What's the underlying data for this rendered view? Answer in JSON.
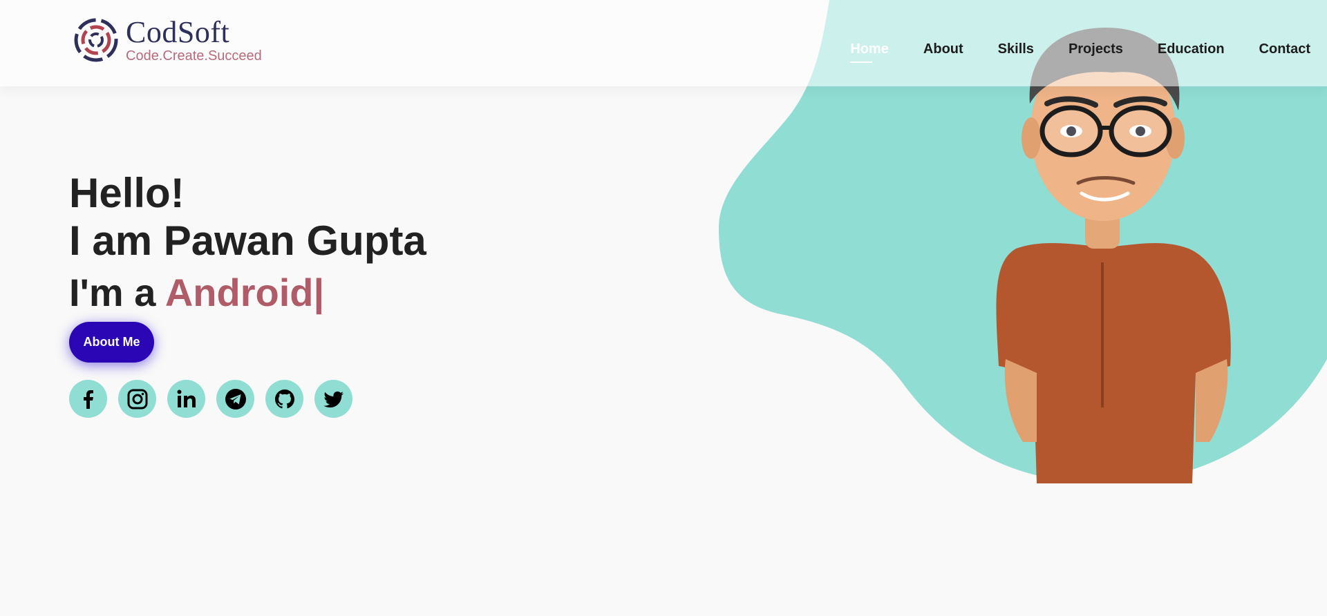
{
  "brand": {
    "name": "CodSoft",
    "tagline": "Code.Create.Succeed"
  },
  "nav": {
    "items": [
      {
        "label": "Home",
        "active": true
      },
      {
        "label": "About"
      },
      {
        "label": "Skills"
      },
      {
        "label": "Projects"
      },
      {
        "label": "Education"
      },
      {
        "label": "Contact"
      }
    ]
  },
  "hero": {
    "greeting": "Hello!",
    "name_line": "I am Pawan Gupta",
    "role_prefix": "I'm a ",
    "role_word": "Android",
    "cursor": "|",
    "about_button": "About Me"
  },
  "socials": [
    {
      "icon": "facebook-icon"
    },
    {
      "icon": "instagram-icon"
    },
    {
      "icon": "linkedin-icon"
    },
    {
      "icon": "telegram-icon"
    },
    {
      "icon": "github-icon"
    },
    {
      "icon": "twitter-icon"
    }
  ],
  "colors": {
    "accent_blob": "#8fddd3",
    "accent_text": "#b05b68",
    "button": "#2a06b5",
    "brand_dark": "#2f2f5c"
  }
}
